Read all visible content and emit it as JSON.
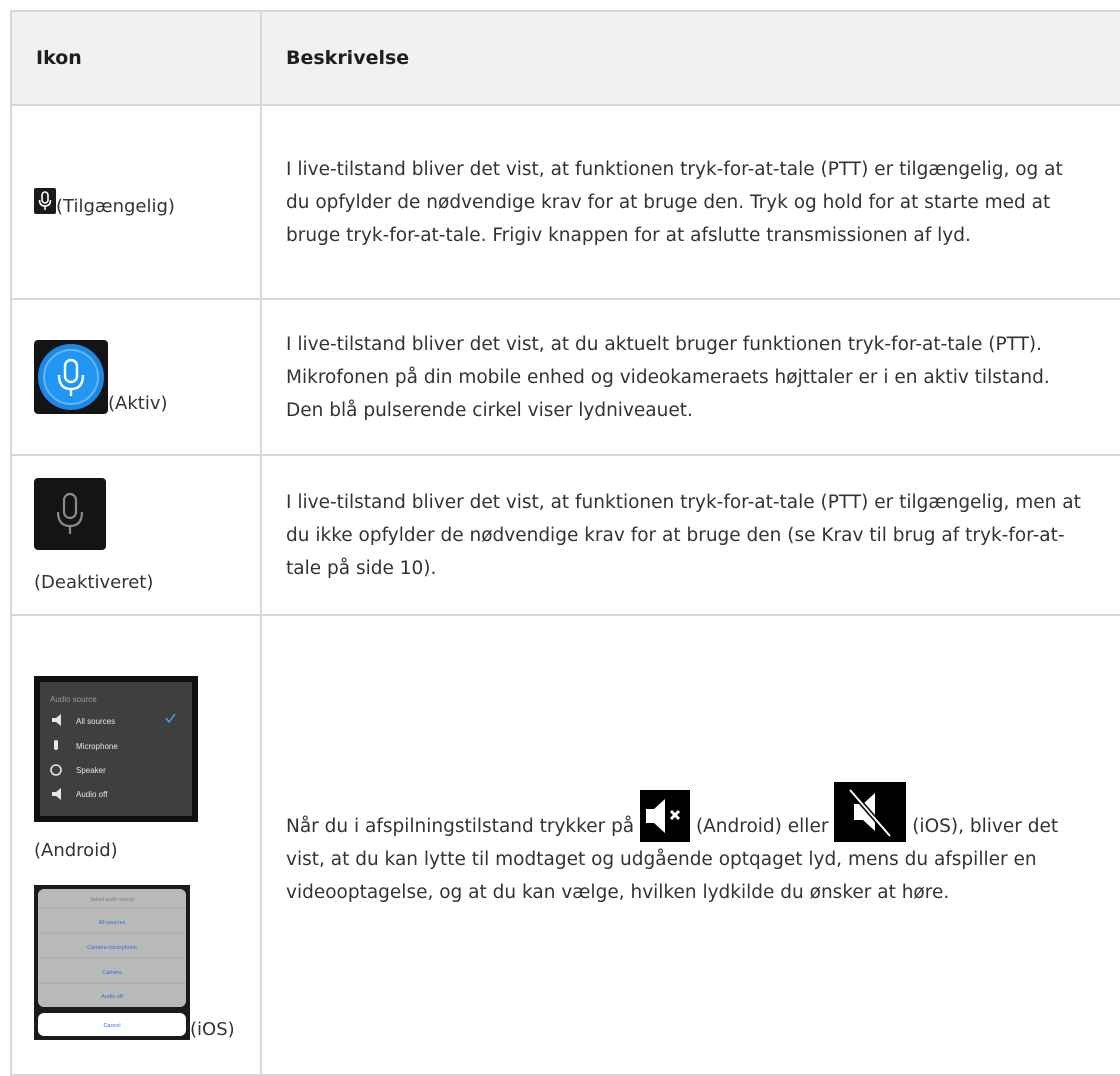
{
  "header": {
    "col_icon": "Ikon",
    "col_desc": "Beskrivelse"
  },
  "rows": [
    {
      "icon_name": "microphone-available-icon",
      "caption": "(Tilgængelig)",
      "description": "I live-tilstand bliver det vist, at funktionen tryk-for-at-tale (PTT) er tilgængelig, og at du opfylder de nødvendige krav for at bruge den. Tryk og hold for at starte med at bruge tryk-for-at-tale. Frigiv knappen for at afslutte transmissionen af lyd."
    },
    {
      "icon_name": "microphone-active-icon",
      "caption": "(Aktiv)",
      "description": "I live-tilstand bliver det vist, at du aktuelt bruger funktionen tryk-for-at-tale (PTT). Mikrofonen på din mobile enhed og videokameraets højttaler er i en aktiv tilstand. Den blå pulserende cirkel viser lydniveauet."
    },
    {
      "icon_name": "microphone-disabled-icon",
      "caption": "(Deaktiveret)",
      "description": "I live-tilstand bliver det vist, at funktionen tryk-for-at-tale (PTT) er tilgængelig, men at du ikke opfylder de nødvendige krav for at bruge den (se Krav til brug af tryk-for-at-tale på side 10)."
    },
    {
      "android_caption": "(Android)",
      "ios_caption": "(iOS)",
      "android_menu": {
        "title": "Audio source",
        "items": [
          {
            "icon": "speaker-icon",
            "label": "All sources",
            "selected": true
          },
          {
            "icon": "microphone-icon",
            "label": "Microphone",
            "selected": false
          },
          {
            "icon": "speaker-output-icon",
            "label": "Speaker",
            "selected": false
          },
          {
            "icon": "audio-off-icon",
            "label": "Audio off",
            "selected": false
          }
        ]
      },
      "ios_menu": {
        "title": "Select audio source",
        "items": [
          "All sources",
          "Camera microphone",
          "Camera",
          "Audio off"
        ],
        "cancel": "Cancel"
      },
      "desc_part1": "Når du i afspilningstilstand trykker på",
      "desc_part2": "(Android) eller",
      "desc_part3": "(iOS), bliver det vist, at du kan lytte til modtaget og udgående optqaget lyd, mens du afspiller en videooptagelse, og at du kan vælge, hvilken lydkilde du ønsker at høre."
    }
  ],
  "colors": {
    "header_bg": "#f1f1f1",
    "border": "#d6d6d6",
    "accent_blue": "#1e88e5",
    "text": "#333333"
  }
}
